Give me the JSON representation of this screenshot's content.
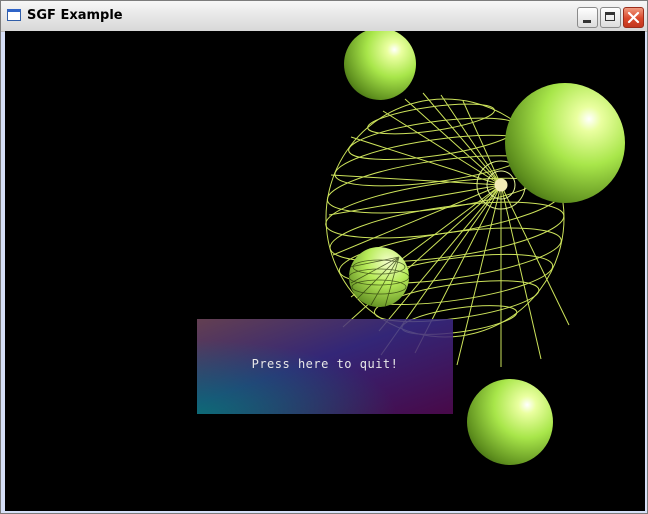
{
  "window": {
    "title": "SGF Example",
    "icon": "window-app-icon",
    "controls": [
      "minimize-icon",
      "maximize-icon",
      "close-icon"
    ]
  },
  "scene": {
    "background": "#000000",
    "sphere_color": "#a8e64a",
    "wireframe_color": "#d8f060",
    "quit_button": {
      "label": "Press here to quit!"
    }
  }
}
